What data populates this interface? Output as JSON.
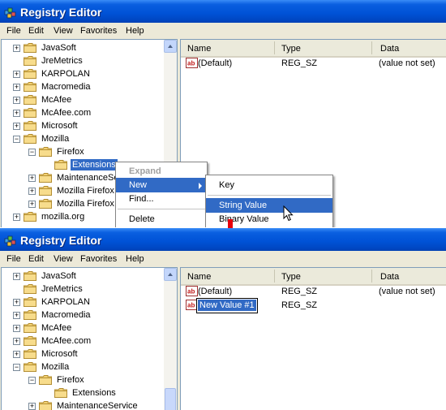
{
  "app": {
    "title": "Registry Editor"
  },
  "menu": [
    "File",
    "Edit",
    "View",
    "Favorites",
    "Help"
  ],
  "top": {
    "tree": [
      {
        "label": "JavaSoft",
        "expander": "+"
      },
      {
        "label": "JreMetrics",
        "expander": ""
      },
      {
        "label": "KARPOLAN",
        "expander": "+"
      },
      {
        "label": "Macromedia",
        "expander": "+"
      },
      {
        "label": "McAfee",
        "expander": "+"
      },
      {
        "label": "McAfee.com",
        "expander": "+"
      },
      {
        "label": "Microsoft",
        "expander": "+"
      },
      {
        "label": "Mozilla",
        "expander": "−"
      },
      {
        "label": "Firefox",
        "expander": "−"
      },
      {
        "label": "Extensions",
        "expander": ""
      },
      {
        "label": "MaintenanceSe",
        "expander": "+"
      },
      {
        "label": "Mozilla Firefox",
        "expander": "+"
      },
      {
        "label": "Mozilla Firefox",
        "expander": "+"
      },
      {
        "label": "mozilla.org",
        "expander": "+"
      }
    ],
    "columns": [
      "Name",
      "Type",
      "Data"
    ],
    "rows": [
      {
        "name": "(Default)",
        "type": "REG_SZ",
        "data": "(value not set)"
      }
    ],
    "context_menu": {
      "expand": "Expand",
      "new": "New",
      "find": "Find...",
      "delete": "Delete"
    },
    "submenu": {
      "key": "Key",
      "string_value": "String Value",
      "binary_value": "Binary Value"
    }
  },
  "bottom": {
    "tree": [
      {
        "label": "JavaSoft",
        "expander": "+"
      },
      {
        "label": "JreMetrics",
        "expander": ""
      },
      {
        "label": "KARPOLAN",
        "expander": "+"
      },
      {
        "label": "Macromedia",
        "expander": "+"
      },
      {
        "label": "McAfee",
        "expander": "+"
      },
      {
        "label": "McAfee.com",
        "expander": "+"
      },
      {
        "label": "Microsoft",
        "expander": "+"
      },
      {
        "label": "Mozilla",
        "expander": "−"
      },
      {
        "label": "Firefox",
        "expander": "−"
      },
      {
        "label": "Extensions",
        "expander": ""
      },
      {
        "label": "MaintenanceService",
        "expander": "+"
      }
    ],
    "columns": [
      "Name",
      "Type",
      "Data"
    ],
    "rows": [
      {
        "name": "(Default)",
        "type": "REG_SZ",
        "data": "(value not set)"
      },
      {
        "name": "New Value #1",
        "type": "REG_SZ",
        "data": ""
      }
    ]
  },
  "colors": {
    "title_bar": "#0052d6",
    "selection": "#316ac5",
    "arrow": "#e8000b"
  },
  "icons": [
    "registry-icon",
    "folder-icon",
    "string-value-icon",
    "mouse-cursor-icon",
    "down-arrow-icon"
  ]
}
